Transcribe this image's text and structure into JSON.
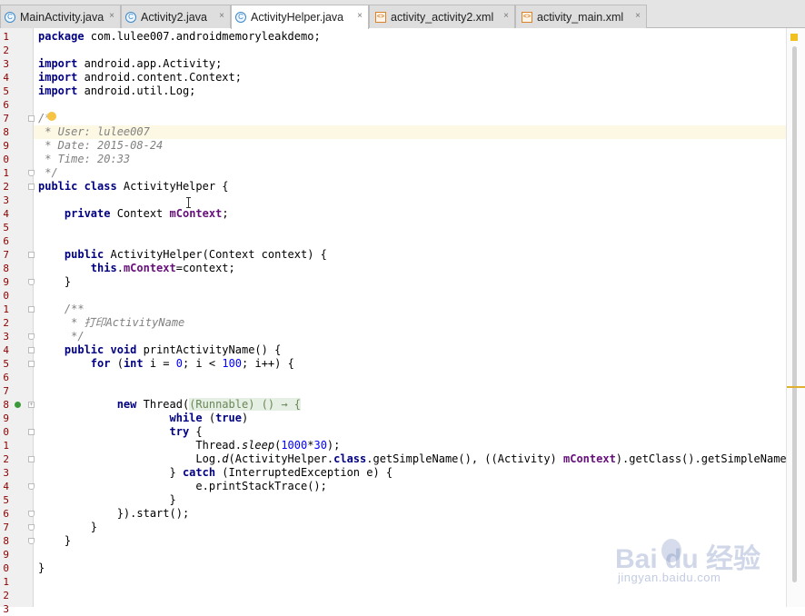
{
  "tabs": [
    {
      "label": "MainActivity.java",
      "icon": "java-class-icon",
      "icon_text": "C"
    },
    {
      "label": "Activity2.java",
      "icon": "java-class-icon",
      "icon_text": "C"
    },
    {
      "label": "ActivityHelper.java",
      "icon": "java-class-icon",
      "icon_text": "C",
      "active": true
    },
    {
      "label": "activity_activity2.xml",
      "icon": "xml-file-icon",
      "icon_text": "<>"
    },
    {
      "label": "activity_main.xml",
      "icon": "xml-file-icon",
      "icon_text": "<>"
    }
  ],
  "close_glyph": "×",
  "line_numbers": [
    "1",
    "2",
    "3",
    "4",
    "5",
    "6",
    "7",
    "8",
    "9",
    "0",
    "1",
    "2",
    "3",
    "4",
    "5",
    "6",
    "7",
    "8",
    "9",
    "0",
    "1",
    "2",
    "3",
    "4",
    "5",
    "6",
    "7",
    "8",
    "9",
    "0",
    "1",
    "2",
    "3",
    "4",
    "5",
    "6",
    "7",
    "8",
    "9",
    "0",
    "1",
    "2",
    "3"
  ],
  "code_lines": [
    [
      {
        "t": "package",
        "c": "kw"
      },
      {
        "t": " com.lulee007.androidmemoryleakdemo;"
      }
    ],
    [],
    [
      {
        "t": "import",
        "c": "kw"
      },
      {
        "t": " android.app.Activity;"
      }
    ],
    [
      {
        "t": "import",
        "c": "kw"
      },
      {
        "t": " android.content.Context;"
      }
    ],
    [
      {
        "t": "import",
        "c": "kw"
      },
      {
        "t": " android.util.Log;"
      }
    ],
    [],
    [
      {
        "t": "/*",
        "c": "cm"
      }
    ],
    [
      {
        "t": " * User: lulee007",
        "c": "cm"
      }
    ],
    [
      {
        "t": " * Date: 2015-08-24",
        "c": "cm"
      }
    ],
    [
      {
        "t": " * Time: 20:33",
        "c": "cm"
      }
    ],
    [
      {
        "t": " */",
        "c": "cm"
      }
    ],
    [
      {
        "t": "public class",
        "c": "kw"
      },
      {
        "t": " ActivityHelper {"
      }
    ],
    [],
    [
      {
        "t": "    "
      },
      {
        "t": "private",
        "c": "kw"
      },
      {
        "t": " Context "
      },
      {
        "t": "mContext",
        "c": "fld"
      },
      {
        "t": ";"
      }
    ],
    [],
    [],
    [
      {
        "t": "    "
      },
      {
        "t": "public",
        "c": "kw"
      },
      {
        "t": " ActivityHelper(Context context) {"
      }
    ],
    [
      {
        "t": "        "
      },
      {
        "t": "this",
        "c": "kw"
      },
      {
        "t": "."
      },
      {
        "t": "mContext",
        "c": "fld"
      },
      {
        "t": "=context;"
      }
    ],
    [
      {
        "t": "    }"
      }
    ],
    [],
    [
      {
        "t": "    /**",
        "c": "cm"
      }
    ],
    [
      {
        "t": "     * 打印ActivityName",
        "c": "cm"
      }
    ],
    [
      {
        "t": "     */",
        "c": "cm"
      }
    ],
    [
      {
        "t": "    "
      },
      {
        "t": "public void",
        "c": "kw"
      },
      {
        "t": " printActivityName() {"
      }
    ],
    [
      {
        "t": "        "
      },
      {
        "t": "for",
        "c": "kw"
      },
      {
        "t": " ("
      },
      {
        "t": "int",
        "c": "kw"
      },
      {
        "t": " i = "
      },
      {
        "t": "0",
        "c": "num"
      },
      {
        "t": "; i < "
      },
      {
        "t": "100",
        "c": "num"
      },
      {
        "t": "; i++) {"
      }
    ],
    [],
    [],
    [
      {
        "t": "            "
      },
      {
        "t": "new",
        "c": "kw"
      },
      {
        "t": " Thread("
      },
      {
        "t": "(Runnable) () → {",
        "c": "fold-h"
      }
    ],
    [
      {
        "t": "                    "
      },
      {
        "t": "while",
        "c": "kw"
      },
      {
        "t": " ("
      },
      {
        "t": "true",
        "c": "kw"
      },
      {
        "t": ")"
      }
    ],
    [
      {
        "t": "                    "
      },
      {
        "t": "try",
        "c": "kw"
      },
      {
        "t": " {"
      }
    ],
    [
      {
        "t": "                        Thread."
      },
      {
        "t": "sleep",
        "c": "st"
      },
      {
        "t": "("
      },
      {
        "t": "1000",
        "c": "num"
      },
      {
        "t": "*"
      },
      {
        "t": "30",
        "c": "num"
      },
      {
        "t": ");"
      }
    ],
    [
      {
        "t": "                        Log."
      },
      {
        "t": "d",
        "c": "st"
      },
      {
        "t": "(ActivityHelper."
      },
      {
        "t": "class",
        "c": "kw"
      },
      {
        "t": ".getSimpleName(), ((Activity) "
      },
      {
        "t": "mContext",
        "c": "fld"
      },
      {
        "t": ").getClass().getSimpleName());"
      }
    ],
    [
      {
        "t": "                    } "
      },
      {
        "t": "catch",
        "c": "kw"
      },
      {
        "t": " (InterruptedException e) {"
      }
    ],
    [
      {
        "t": "                        e.printStackTrace();"
      }
    ],
    [
      {
        "t": "                    }"
      }
    ],
    [
      {
        "t": "            }).start();"
      }
    ],
    [
      {
        "t": "        }"
      }
    ],
    [
      {
        "t": "    }"
      }
    ],
    [],
    [
      {
        "t": "}"
      }
    ],
    [],
    [],
    []
  ],
  "watermark": {
    "logo": "Bai  du 经验",
    "url": "jingyan.baidu.com"
  }
}
